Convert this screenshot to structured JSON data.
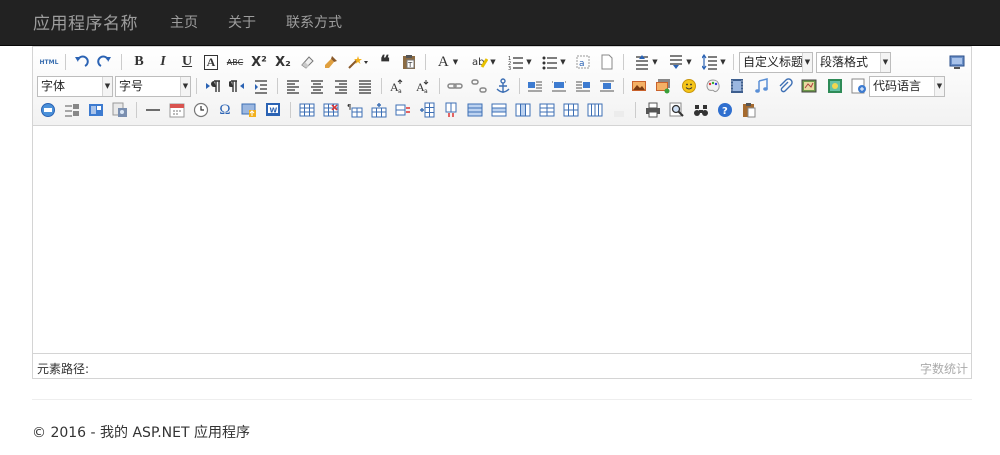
{
  "navbar": {
    "brand": "应用程序名称",
    "links": [
      "主页",
      "关于",
      "联系方式"
    ],
    "background": "#222222",
    "link_color": "#9d9d9d"
  },
  "toolbar": {
    "html_button": "HTML",
    "bold": "B",
    "italic": "I",
    "underline": "U",
    "fontborder": "A",
    "strike": "ABC",
    "superscript": "X²",
    "subscript": "X₂",
    "quote": "❝",
    "forecolor": "A",
    "custom_heading": "自定义标题",
    "paragraph_format": "段落格式",
    "font_family": "字体",
    "font_size": "字号",
    "code_language": "代码语言",
    "omega": "Ω"
  },
  "statusbar": {
    "element_path": "元素路径:",
    "word_count": "字数统计"
  },
  "footer": {
    "text": "© 2016 - 我的 ASP.NET 应用程序"
  }
}
